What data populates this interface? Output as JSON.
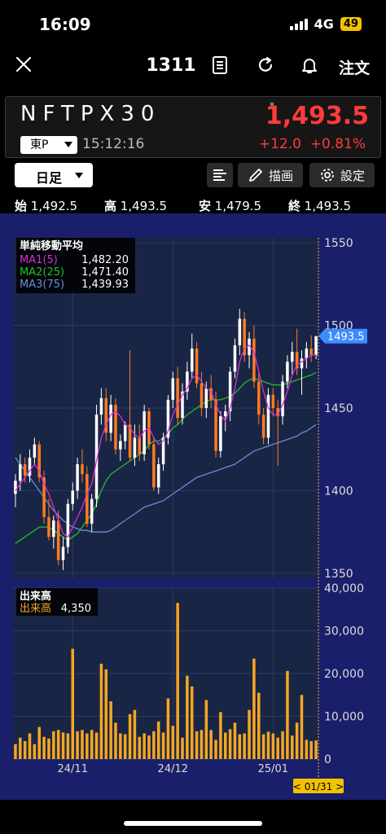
{
  "status": {
    "time": "16:09",
    "network": "4G",
    "battery": "49"
  },
  "nav": {
    "title": "1311",
    "order_label": "注文"
  },
  "quote": {
    "name": "NFTPX30",
    "exchange": "東P",
    "time": "15:12:16",
    "marker": "*",
    "price": "1,493.5",
    "change": "+12.0",
    "change_pct": "+0.81%"
  },
  "toolbar": {
    "period": "日足",
    "draw": "描画",
    "settings": "設定"
  },
  "ohlc": [
    {
      "label": "始",
      "value": "1,492.5"
    },
    {
      "label": "高",
      "value": "1,493.5"
    },
    {
      "label": "安",
      "value": "1,479.5"
    },
    {
      "label": "終",
      "value": "1,493.5"
    }
  ],
  "colors": {
    "background": "#1a1f6b",
    "panel": "#192545",
    "up": "#ffffff",
    "down": "#ff7a21",
    "ma1": "#d82fd8",
    "ma2": "#22c022",
    "ma3": "#6b8cd8",
    "volume": "#f5a623",
    "price_tag": "#3b8cff"
  },
  "chart_data": [
    {
      "type": "candlestick",
      "legend_title": "単純移動平均",
      "series": [
        {
          "name": "MA1(5)",
          "value": "1,482.20"
        },
        {
          "name": "MA2(25)",
          "value": "1,471.40"
        },
        {
          "name": "MA3(75)",
          "value": "1,439.93"
        }
      ],
      "ylim": [
        1347,
        1553
      ],
      "yticks": [
        1350,
        1400,
        1450,
        1500,
        1550
      ],
      "xticks": [
        "24/11",
        "24/12",
        "25/01"
      ],
      "last_price_tag": "1493.5",
      "candles": [
        [
          1398,
          1410,
          1390,
          1406
        ],
        [
          1406,
          1422,
          1400,
          1416
        ],
        [
          1416,
          1420,
          1405,
          1409
        ],
        [
          1409,
          1425,
          1405,
          1420
        ],
        [
          1420,
          1432,
          1416,
          1428
        ],
        [
          1428,
          1430,
          1405,
          1408
        ],
        [
          1408,
          1412,
          1380,
          1384
        ],
        [
          1384,
          1395,
          1370,
          1372
        ],
        [
          1372,
          1385,
          1365,
          1382
        ],
        [
          1382,
          1388,
          1355,
          1358
        ],
        [
          1358,
          1372,
          1352,
          1366
        ],
        [
          1366,
          1395,
          1362,
          1392
        ],
        [
          1392,
          1405,
          1388,
          1400
        ],
        [
          1400,
          1420,
          1395,
          1416
        ],
        [
          1416,
          1425,
          1405,
          1410
        ],
        [
          1410,
          1415,
          1378,
          1380
        ],
        [
          1380,
          1398,
          1375,
          1395
        ],
        [
          1395,
          1452,
          1390,
          1446
        ],
        [
          1446,
          1462,
          1440,
          1456
        ],
        [
          1456,
          1462,
          1430,
          1435
        ],
        [
          1435,
          1458,
          1430,
          1452
        ],
        [
          1452,
          1456,
          1422,
          1425
        ],
        [
          1425,
          1434,
          1418,
          1430
        ],
        [
          1430,
          1442,
          1425,
          1440
        ],
        [
          1440,
          1485,
          1418,
          1420
        ],
        [
          1420,
          1440,
          1415,
          1432
        ],
        [
          1432,
          1440,
          1418,
          1422
        ],
        [
          1422,
          1452,
          1418,
          1448
        ],
        [
          1448,
          1450,
          1425,
          1428
        ],
        [
          1428,
          1432,
          1400,
          1402
        ],
        [
          1402,
          1420,
          1398,
          1416
        ],
        [
          1416,
          1435,
          1412,
          1432
        ],
        [
          1432,
          1458,
          1428,
          1455
        ],
        [
          1455,
          1472,
          1450,
          1468
        ],
        [
          1468,
          1475,
          1440,
          1444
        ],
        [
          1444,
          1465,
          1440,
          1460
        ],
        [
          1460,
          1478,
          1455,
          1472
        ],
        [
          1472,
          1495,
          1468,
          1486
        ],
        [
          1486,
          1490,
          1462,
          1465
        ],
        [
          1465,
          1472,
          1445,
          1450
        ],
        [
          1450,
          1466,
          1444,
          1462
        ],
        [
          1462,
          1470,
          1450,
          1455
        ],
        [
          1455,
          1460,
          1420,
          1424
        ],
        [
          1424,
          1448,
          1420,
          1445
        ],
        [
          1445,
          1452,
          1436,
          1448
        ],
        [
          1448,
          1475,
          1442,
          1472
        ],
        [
          1472,
          1492,
          1468,
          1488
        ],
        [
          1488,
          1510,
          1482,
          1504
        ],
        [
          1504,
          1508,
          1478,
          1482
        ],
        [
          1482,
          1496,
          1474,
          1492
        ],
        [
          1492,
          1500,
          1462,
          1466
        ],
        [
          1466,
          1472,
          1440,
          1446
        ],
        [
          1446,
          1450,
          1428,
          1432
        ],
        [
          1432,
          1462,
          1428,
          1458
        ],
        [
          1458,
          1462,
          1445,
          1450
        ],
        [
          1450,
          1455,
          1415,
          1445
        ],
        [
          1445,
          1470,
          1440,
          1466
        ],
        [
          1466,
          1482,
          1462,
          1478
        ],
        [
          1478,
          1490,
          1470,
          1484
        ],
        [
          1484,
          1498,
          1470,
          1474
        ],
        [
          1474,
          1485,
          1458,
          1480
        ],
        [
          1480,
          1490,
          1474,
          1486
        ],
        [
          1486,
          1494,
          1478,
          1482
        ],
        [
          1482,
          1493.5,
          1479.5,
          1493.5
        ]
      ],
      "ma1": [
        1400,
        1404,
        1408,
        1412,
        1416,
        1412,
        1404,
        1398,
        1390,
        1382,
        1374,
        1372,
        1378,
        1384,
        1390,
        1398,
        1404,
        1418,
        1432,
        1440,
        1446,
        1448,
        1445,
        1440,
        1438,
        1434,
        1432,
        1436,
        1438,
        1432,
        1428,
        1430,
        1436,
        1446,
        1452,
        1458,
        1462,
        1468,
        1470,
        1466,
        1462,
        1460,
        1452,
        1446,
        1442,
        1450,
        1462,
        1478,
        1486,
        1488,
        1484,
        1472,
        1460,
        1450,
        1446,
        1446,
        1452,
        1460,
        1470,
        1476,
        1478,
        1480,
        1482,
        1482.2
      ],
      "ma2": [
        1368,
        1370,
        1372,
        1374,
        1376,
        1378,
        1378,
        1378,
        1376,
        1374,
        1372,
        1370,
        1372,
        1374,
        1378,
        1382,
        1386,
        1392,
        1400,
        1406,
        1410,
        1412,
        1414,
        1416,
        1418,
        1420,
        1422,
        1424,
        1428,
        1430,
        1430,
        1432,
        1434,
        1438,
        1440,
        1443,
        1446,
        1448,
        1450,
        1452,
        1454,
        1455,
        1455,
        1455,
        1456,
        1457,
        1459,
        1462,
        1465,
        1467,
        1468,
        1467,
        1466,
        1465,
        1464,
        1464,
        1464,
        1465,
        1466,
        1467,
        1468,
        1469,
        1470,
        1471.4
      ],
      "ma3": [
        1420,
        1416,
        1412,
        1408,
        1404,
        1400,
        1396,
        1392,
        1388,
        1385,
        1382,
        1380,
        1378,
        1377,
        1376,
        1376,
        1375,
        1375,
        1375,
        1375,
        1376,
        1378,
        1380,
        1382,
        1384,
        1386,
        1388,
        1390,
        1391,
        1392,
        1393,
        1394,
        1396,
        1398,
        1400,
        1402,
        1404,
        1406,
        1408,
        1409,
        1410,
        1411,
        1412,
        1413,
        1414,
        1415,
        1416,
        1418,
        1420,
        1422,
        1424,
        1425,
        1426,
        1427,
        1428,
        1429,
        1430,
        1431,
        1432,
        1433,
        1435,
        1436,
        1438,
        1439.93
      ]
    },
    {
      "type": "bar",
      "legend_title": "出来高",
      "series_name": "出来高",
      "last_value": "4,350",
      "ylim": [
        0,
        40000
      ],
      "yticks": [
        "40,000",
        "30,000",
        "20,000",
        "10,000",
        "0"
      ],
      "cursor_date": "< 01/31 >",
      "values": [
        3500,
        5000,
        4200,
        6000,
        3500,
        7500,
        5200,
        4800,
        6500,
        6800,
        6200,
        6000,
        25800,
        6500,
        6800,
        6000,
        6800,
        6200,
        22300,
        21000,
        13500,
        8500,
        6000,
        5800,
        10500,
        11500,
        5200,
        6000,
        5500,
        6500,
        8800,
        6200,
        14200,
        7800,
        36500,
        5000,
        19500,
        17000,
        6500,
        6800,
        13800,
        6800,
        4500,
        11000,
        6200,
        7000,
        8500,
        5800,
        6000,
        11500,
        23500,
        15500,
        5800,
        6400,
        6000,
        5000,
        6500,
        20600,
        5500,
        8500,
        15000,
        4500,
        4200,
        4350
      ]
    }
  ]
}
